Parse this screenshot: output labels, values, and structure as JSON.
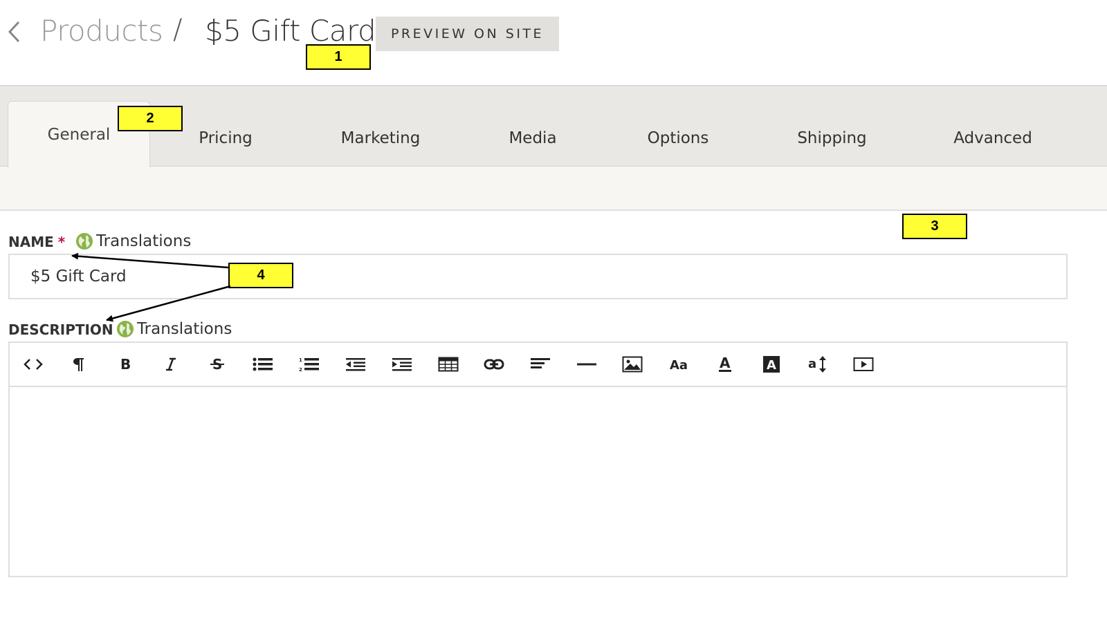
{
  "header": {
    "breadcrumb_parent": "Products",
    "breadcrumb_separator": "/",
    "breadcrumb_current": "$5 Gift Card",
    "preview_button": "PREVIEW ON SITE"
  },
  "tabs": [
    {
      "label": "General",
      "active": true
    },
    {
      "label": "Pricing",
      "active": false
    },
    {
      "label": "Marketing",
      "active": false
    },
    {
      "label": "Media",
      "active": false
    },
    {
      "label": "Options",
      "active": false
    },
    {
      "label": "Shipping",
      "active": false
    },
    {
      "label": "Advanced",
      "active": false
    }
  ],
  "form": {
    "name_label": "NAME",
    "required_mark": "*",
    "name_translations": "Translations",
    "name_value": "$5 Gift Card",
    "description_label": "DESCRIPTION",
    "description_translations": "Translations",
    "toolbar_buttons": [
      "html-code",
      "paragraph-format",
      "bold",
      "italic",
      "strikethrough",
      "unordered-list",
      "ordered-list",
      "outdent",
      "indent",
      "table",
      "link",
      "align",
      "horizontal-rule",
      "image",
      "font-family",
      "font-color",
      "background-color",
      "line-height",
      "video"
    ]
  },
  "annotations": {
    "a1": "1",
    "a2": "2",
    "a3": "3",
    "a4": "4"
  },
  "colors": {
    "tab_band": "#e9e8e4",
    "active_tab": "#f7f6f3",
    "required": "#c0143c",
    "globe": "#8ab34a",
    "annotation": "#ffff33"
  }
}
